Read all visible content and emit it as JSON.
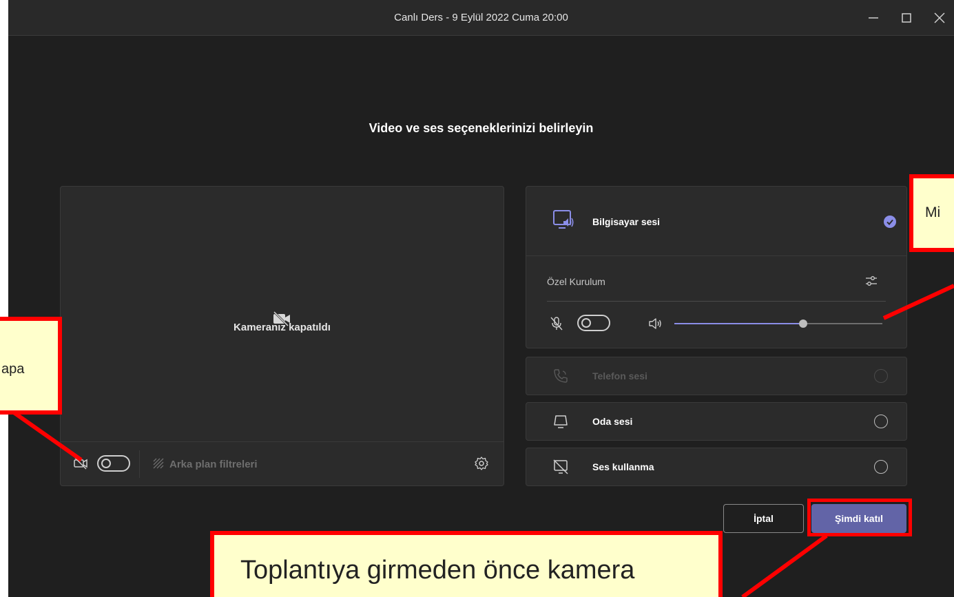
{
  "window": {
    "title": "Canlı Ders - 9 Eylül 2022 Cuma 20:00",
    "controls": [
      "minimize-icon",
      "maximize-icon",
      "close-icon"
    ]
  },
  "heading": "Video ve ses seçeneklerinizi belirleyin",
  "video": {
    "camera_off_text": "Kameranız kapatıldı",
    "camera_toggle_on": false,
    "background_filters_label": "Arka plan filtreleri"
  },
  "audio": {
    "computer_audio_label": "Bilgisayar sesi",
    "custom_setup_label": "Özel Kurulum",
    "mic_toggle_on": false,
    "speaker_volume_fraction": 0.62,
    "options": [
      {
        "label": "Telefon sesi",
        "disabled": true
      },
      {
        "label": "Oda sesi",
        "disabled": false
      },
      {
        "label": "Ses kullanma",
        "disabled": false
      }
    ]
  },
  "buttons": {
    "cancel": "İptal",
    "join_now": "Şimdi katıl"
  },
  "annotations": {
    "left_callout": "apa",
    "right_callout": "Mi",
    "bottom_callout": "Toplantıya girmeden önce kamera"
  },
  "colors": {
    "window_bg": "#1f1f1f",
    "panel_bg": "#2b2b2b",
    "accent": "#6264a7",
    "slider_fill": "#8b8ee8",
    "annotation_fill": "#ffffcc",
    "annotation_border": "#ff0000"
  }
}
